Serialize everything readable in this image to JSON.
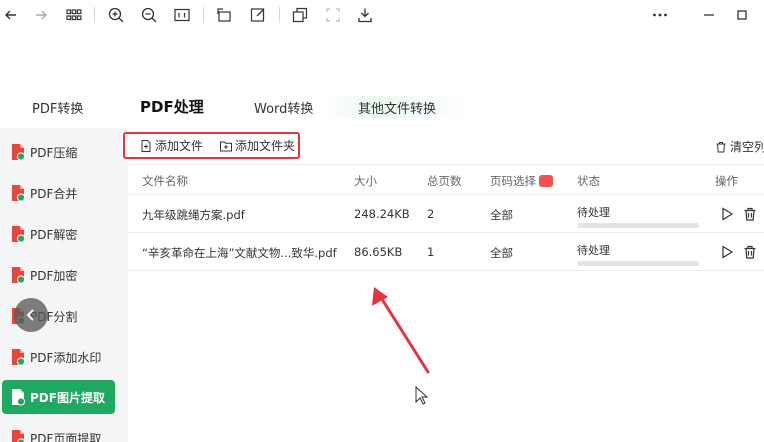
{
  "main_tabs": [
    {
      "label": "PDF转换"
    },
    {
      "label": "PDF处理",
      "active": true
    },
    {
      "label": "Word转换"
    },
    {
      "label": "其他文件转换"
    }
  ],
  "sidebar": {
    "items": [
      {
        "label": "PDF压缩"
      },
      {
        "label": "PDF合并"
      },
      {
        "label": "PDF解密"
      },
      {
        "label": "PDF加密"
      },
      {
        "label": "PDF分割"
      },
      {
        "label": "PDF添加水印"
      },
      {
        "label": "PDF图片提取",
        "active": true
      },
      {
        "label": "PDF页面提取"
      }
    ]
  },
  "actions": {
    "add_file": "添加文件",
    "add_folder": "添加文件夹",
    "clear_list": "清空列"
  },
  "table": {
    "headers": [
      "文件名称",
      "大小",
      "总页数",
      "页码选择",
      "状态",
      "操作"
    ],
    "rows": [
      {
        "name": "九年级跳绳方案.pdf",
        "size": "248.24KB",
        "pages": "2",
        "page_select": "全部",
        "status": "待处理",
        "progress": 0
      },
      {
        "name": "“辛亥革命在上海”文献文物...致华.pdf",
        "size": "86.65KB",
        "pages": "1",
        "page_select": "全部",
        "status": "待处理",
        "progress": 0
      }
    ]
  },
  "colors": {
    "accent_green": "#1fa85f",
    "highlight_red": "#e5343f",
    "pdf_red": "#e8453c"
  }
}
